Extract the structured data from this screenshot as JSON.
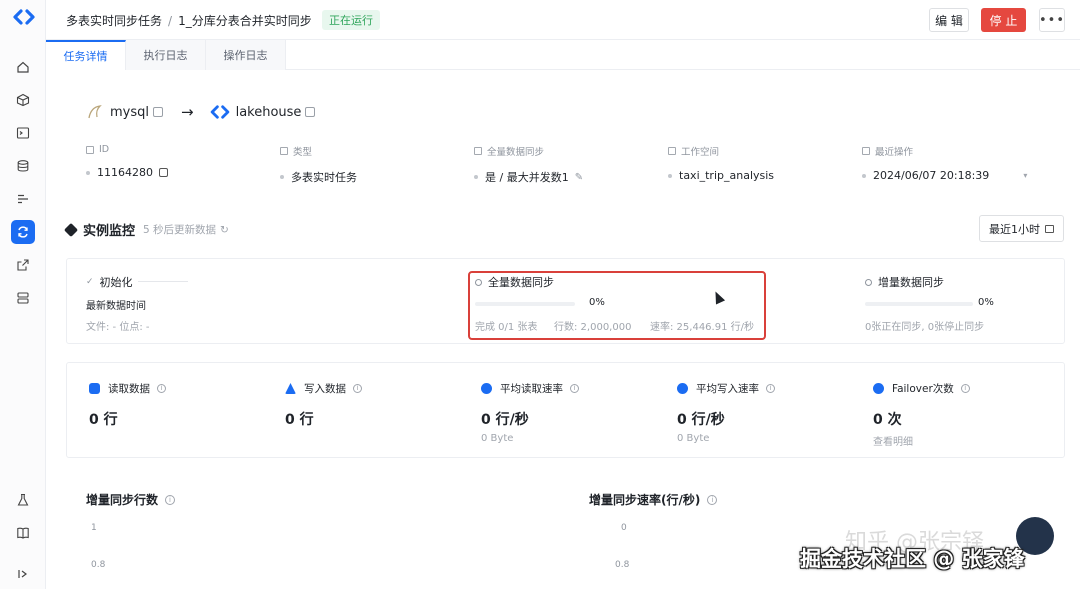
{
  "header": {
    "breadcrumb_parent": "多表实时同步任务",
    "breadcrumb_sep": "/",
    "task_name": "1_分库分表合并实时同步",
    "status": "正在运行",
    "edit_label": "编 辑",
    "stop_label": "停 止",
    "more_label": "•••"
  },
  "tabs": [
    {
      "label": "任务详情",
      "active": true
    },
    {
      "label": "执行日志",
      "active": false
    },
    {
      "label": "操作日志",
      "active": false
    }
  ],
  "flow": {
    "source": "mysql",
    "arrow": "→",
    "target": "lakehouse"
  },
  "info": [
    {
      "label": "ID",
      "value": "11164280"
    },
    {
      "label": "类型",
      "value": "多表实时任务"
    },
    {
      "label": "全量数据同步",
      "value": "是 / 最大并发数1"
    },
    {
      "label": "工作空间",
      "value": "taxi_trip_analysis"
    },
    {
      "label": "最近操作",
      "value": "2024/06/07 20:18:39"
    }
  ],
  "monitor": {
    "title": "实例监控",
    "refresh_hint": "5 秒后更新数据",
    "range_label": "最近1小时"
  },
  "stages": {
    "init": {
      "title": "初始化",
      "latest_time_label": "最新数据时间",
      "file_pos": "文件: -   位点: -"
    },
    "full": {
      "title": "全量数据同步",
      "percent_text": "0%",
      "progress": 0,
      "done": "完成 0/1 张表",
      "rows": "行数: 2,000,000",
      "rate": "速率: 25,446.91 行/秒"
    },
    "incr": {
      "title": "增量数据同步",
      "percent_text": "0%",
      "progress": 0,
      "summary": "0张正在同步, 0张停止同步"
    }
  },
  "stats": [
    {
      "label": "读取数据",
      "value": "0 行",
      "sub": ""
    },
    {
      "label": "写入数据",
      "value": "0 行",
      "sub": ""
    },
    {
      "label": "平均读取速率",
      "value": "0 行/秒",
      "sub": "0 Byte"
    },
    {
      "label": "平均写入速率",
      "value": "0 行/秒",
      "sub": "0 Byte"
    },
    {
      "label": "Failover次数",
      "value": "0 次",
      "sub": "查看明细"
    }
  ],
  "charts": {
    "left_title": "增量同步行数",
    "right_title": "增量同步速率(行/秒)",
    "left_ticks": [
      "1",
      "0.8"
    ],
    "right_ticks": [
      "0",
      "0.8"
    ]
  },
  "watermark": {
    "faint": "知乎 @张宗铎",
    "main": "掘金技术社区 @ 张家锋"
  },
  "colors": {
    "accent": "#1b6cf2",
    "stop": "#e5483f",
    "running": "#2fa55b",
    "highlight": "#d9403a"
  }
}
